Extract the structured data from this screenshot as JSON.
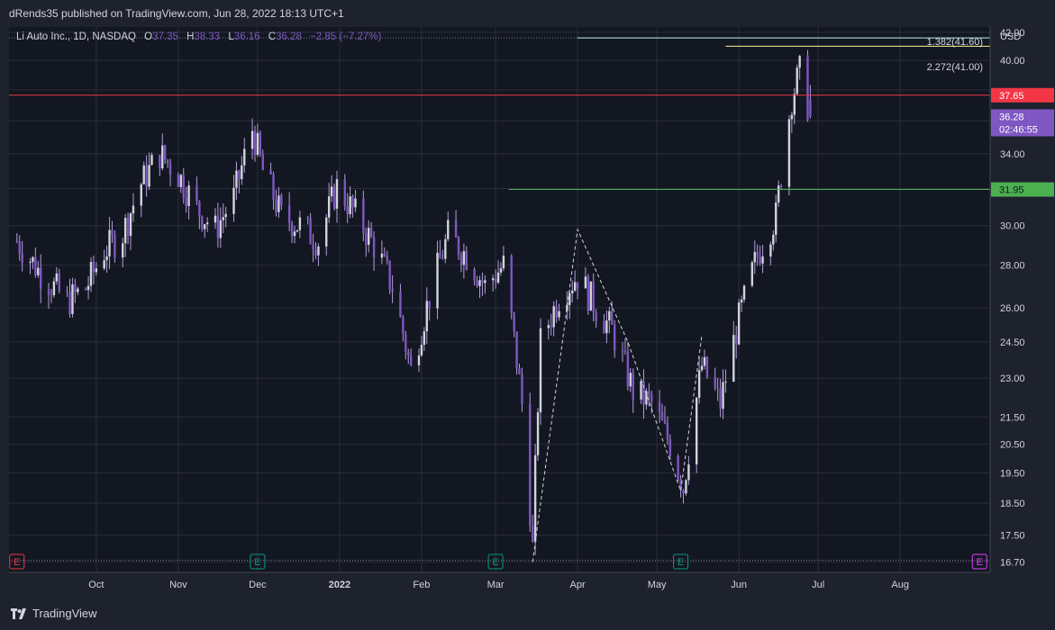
{
  "header": {
    "publisher_line": "dRends35 published on TradingView.com, Jun 28, 2022 18:13 UTC+1"
  },
  "legend": {
    "symbol": "Li Auto Inc., 1D, NASDAQ",
    "o_label": "O",
    "o_value": "37.35",
    "h_label": "H",
    "h_value": "38.33",
    "l_label": "L",
    "l_value": "36.16",
    "c_label": "C",
    "c_value": "36.28",
    "change": "−2.85 (−7.27%)"
  },
  "footer": {
    "brand": "TradingView"
  },
  "colors": {
    "background": "#1e222d",
    "plot_bg": "#131722",
    "grid": "#2a2e39",
    "candle": "#7e57c2",
    "wick": "#b39ddb",
    "resistance": "#f23645",
    "support": "#4caf50",
    "fib_a": "#b2ebf2",
    "fib_b": "#fff59d",
    "last_price": "#7e57c2"
  },
  "chart_data": {
    "type": "candlestick",
    "ylabel": "USD",
    "y_scale": "log",
    "ylim": [
      16.4,
      42.4
    ],
    "y_ticks": [
      "42.00",
      "40.00",
      "38.00",
      "36.00",
      "34.00",
      "32.00",
      "30.00",
      "28.00",
      "26.00",
      "24.50",
      "23.00",
      "21.50",
      "20.50",
      "19.50",
      "18.50",
      "17.50",
      "16.70"
    ],
    "x_ticks": [
      "Oct",
      "Nov",
      "Dec",
      "2022",
      "Feb",
      "Mar",
      "Apr",
      "May",
      "Jun",
      "Jul",
      "Aug"
    ],
    "earnings_markers": [
      {
        "date": "2021-09-01",
        "label": "E",
        "color": "#f23645"
      },
      {
        "date": "2021-12-01",
        "label": "E",
        "color": "#089981"
      },
      {
        "date": "2022-03-01",
        "label": "E",
        "color": "#089981"
      },
      {
        "date": "2022-05-10",
        "label": "E",
        "color": "#089981"
      },
      {
        "date": "2022-08-31",
        "label": "E",
        "color": "#e040fb"
      }
    ],
    "horizontal_levels": [
      {
        "price": 37.65,
        "label": "37.65",
        "color": "#f23645"
      },
      {
        "price": 31.95,
        "label": "31.95",
        "color": "#4caf50"
      }
    ],
    "fib_levels": [
      {
        "label": "1.382(41.60)",
        "price": 41.6,
        "color": "#b2ebf2",
        "start": "2022-04-01"
      },
      {
        "label": "2.272(41.00)",
        "price": 41.0,
        "color": "#fff59d",
        "start": "2022-05-27"
      }
    ],
    "last_price": {
      "price": 36.28,
      "label": "36.28",
      "countdown": "02:46:55"
    },
    "dashed_path": [
      {
        "date": "2022-03-15",
        "price": 16.7
      },
      {
        "date": "2022-04-01",
        "price": 29.8
      },
      {
        "date": "2022-04-20",
        "price": 24.5
      },
      {
        "date": "2022-05-10",
        "price": 18.9
      },
      {
        "date": "2022-05-18",
        "price": 24.8
      }
    ],
    "series": [
      {
        "date": "2021-09-01",
        "close": 29.2
      },
      {
        "date": "2021-09-10",
        "close": 27.6
      },
      {
        "date": "2021-09-20",
        "close": 26.3
      },
      {
        "date": "2021-09-27",
        "close": 26.9
      },
      {
        "date": "2021-10-04",
        "close": 28.7
      },
      {
        "date": "2021-10-11",
        "close": 29.6
      },
      {
        "date": "2021-10-18",
        "close": 32.3
      },
      {
        "date": "2021-10-25",
        "close": 34.0
      },
      {
        "date": "2021-11-01",
        "close": 32.8
      },
      {
        "date": "2021-11-08",
        "close": 30.9
      },
      {
        "date": "2021-11-15",
        "close": 29.8
      },
      {
        "date": "2021-11-22",
        "close": 31.5
      },
      {
        "date": "2021-11-29",
        "close": 35.5
      },
      {
        "date": "2021-12-03",
        "close": 33.0
      },
      {
        "date": "2021-12-10",
        "close": 30.5
      },
      {
        "date": "2021-12-17",
        "close": 30.0
      },
      {
        "date": "2021-12-24",
        "close": 29.2
      },
      {
        "date": "2021-12-31",
        "close": 32.1
      },
      {
        "date": "2022-01-07",
        "close": 30.6
      },
      {
        "date": "2022-01-14",
        "close": 29.0
      },
      {
        "date": "2022-01-21",
        "close": 27.0
      },
      {
        "date": "2022-01-28",
        "close": 23.3
      },
      {
        "date": "2022-02-04",
        "close": 26.5
      },
      {
        "date": "2022-02-11",
        "close": 29.5
      },
      {
        "date": "2022-02-18",
        "close": 28.5
      },
      {
        "date": "2022-02-25",
        "close": 27.0
      },
      {
        "date": "2022-03-04",
        "close": 28.0
      },
      {
        "date": "2022-03-11",
        "close": 22.0
      },
      {
        "date": "2022-03-15",
        "close": 17.1
      },
      {
        "date": "2022-03-18",
        "close": 24.5
      },
      {
        "date": "2022-03-25",
        "close": 26.5
      },
      {
        "date": "2022-04-01",
        "close": 27.5
      },
      {
        "date": "2022-04-08",
        "close": 26.0
      },
      {
        "date": "2022-04-14",
        "close": 25.0
      },
      {
        "date": "2022-04-22",
        "close": 22.5
      },
      {
        "date": "2022-04-29",
        "close": 22.0
      },
      {
        "date": "2022-05-06",
        "close": 20.5
      },
      {
        "date": "2022-05-11",
        "close": 19.0
      },
      {
        "date": "2022-05-18",
        "close": 23.5
      },
      {
        "date": "2022-05-25",
        "close": 22.0
      },
      {
        "date": "2022-06-01",
        "close": 25.5
      },
      {
        "date": "2022-06-08",
        "close": 28.5
      },
      {
        "date": "2022-06-15",
        "close": 30.5
      },
      {
        "date": "2022-06-21",
        "close": 37.5
      },
      {
        "date": "2022-06-24",
        "close": 39.2
      },
      {
        "date": "2022-06-28",
        "close": 36.28
      }
    ]
  }
}
